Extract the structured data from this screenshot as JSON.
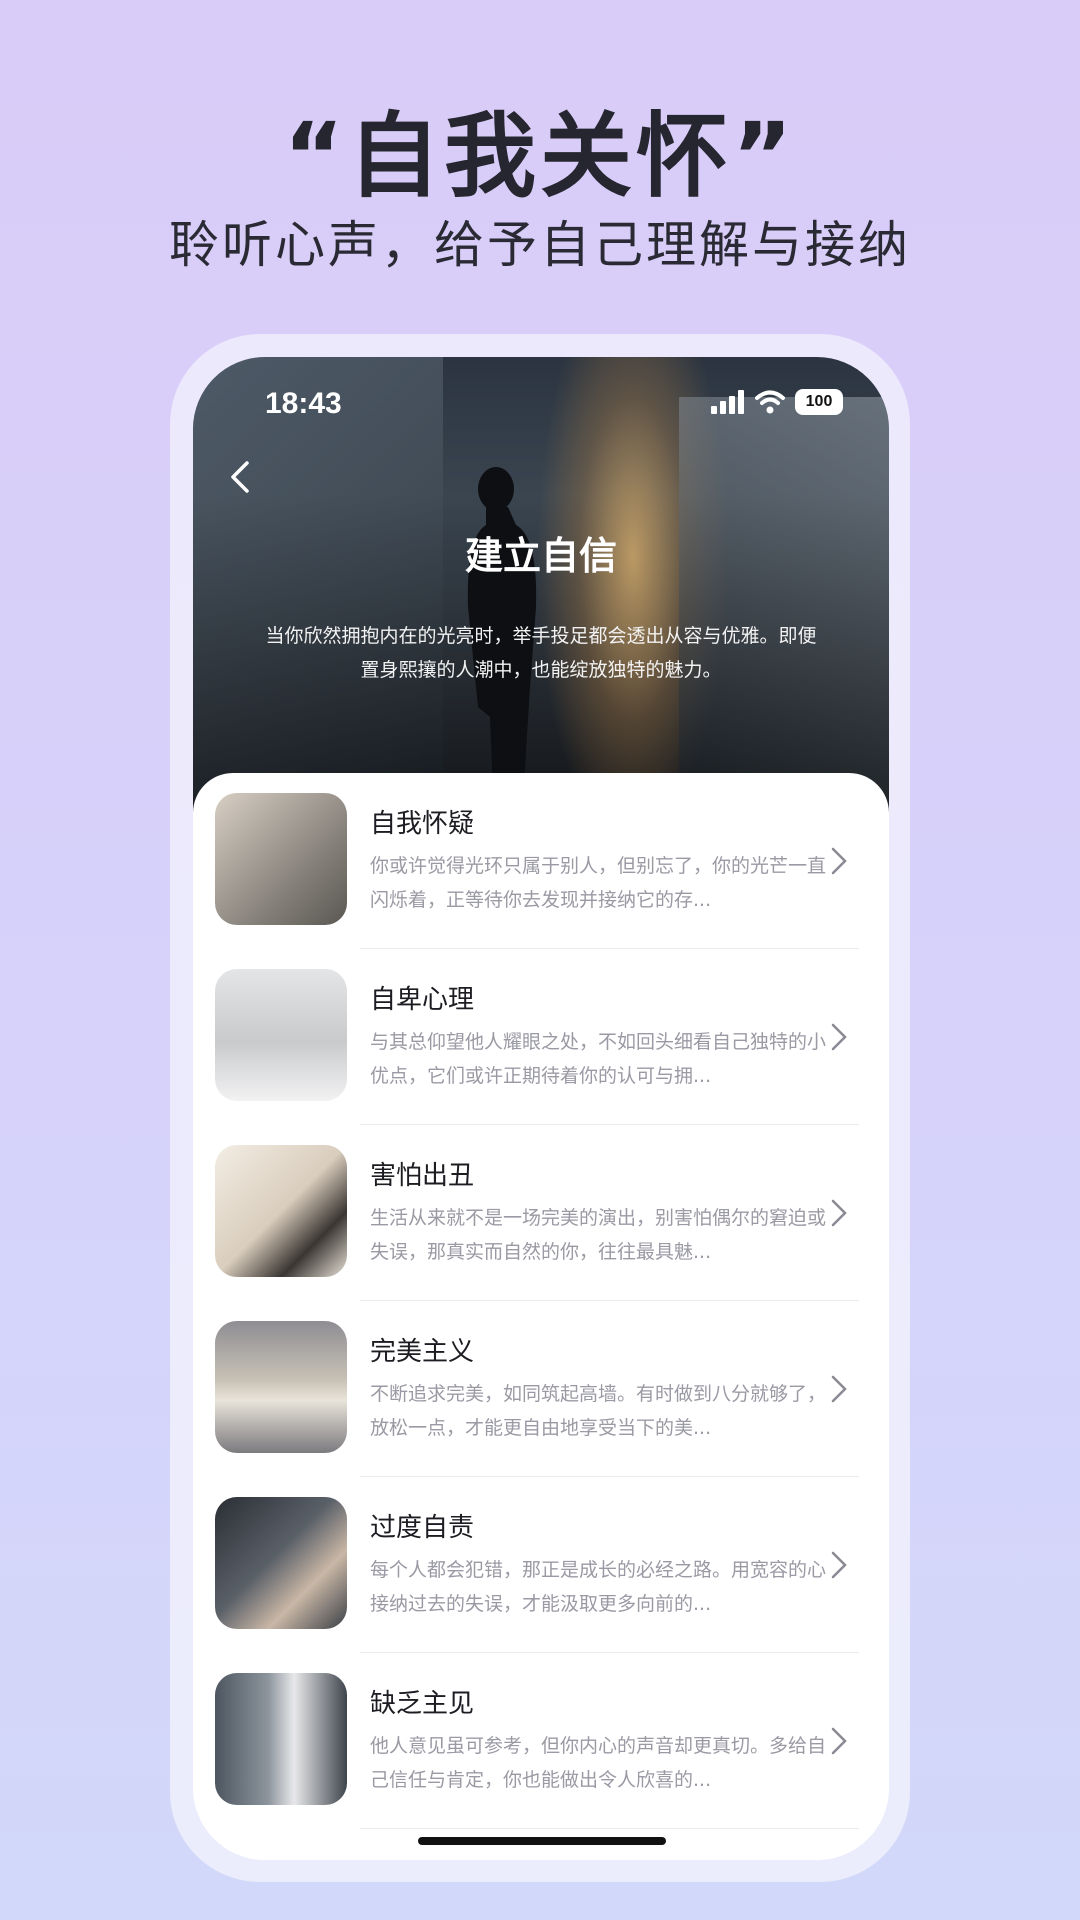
{
  "promo": {
    "title": "“自我关怀”",
    "subtitle": "聆听心声，给予自己理解与接纳"
  },
  "status_bar": {
    "time": "18:43",
    "battery": "100",
    "icons": [
      "signal-icon",
      "wifi-icon",
      "battery-icon"
    ]
  },
  "hero": {
    "back_icon": "chevron-left-icon",
    "title": "建立自信",
    "description": "当你欣然拥抱内在的光亮时，举手投足都会透出从容与优雅。即便置身熙攘的人潮中，也能绽放独特的魅力。"
  },
  "topics": [
    {
      "title": "自我怀疑",
      "desc": "你或许觉得光环只属于别人，但别忘了，你的光芒一直闪烁着，正等待你去发现并接纳它的存...",
      "thumb_color": "#b8b2a8"
    },
    {
      "title": "自卑心理",
      "desc": "与其总仰望他人耀眼之处，不如回头细看自己独特的小优点，它们或许正期待着你的认可与拥...",
      "thumb_color": "#d9dadb"
    },
    {
      "title": "害怕出丑",
      "desc": "生活从来就不是一场完美的演出，别害怕偶尔的窘迫或失误，那真实而自然的你，往往最具魅...",
      "thumb_color": "#e6ddd0"
    },
    {
      "title": "完美主义",
      "desc": "不断追求完美，如同筑起高墙。有时做到八分就够了，放松一点，才能更自由地享受当下的美...",
      "thumb_color": "#a9a6ab"
    },
    {
      "title": "过度自责",
      "desc": "每个人都会犯错，那正是成长的必经之路。用宽容的心接纳过去的失误，才能汲取更多向前的...",
      "thumb_color": "#4a4f57"
    },
    {
      "title": "缺乏主见",
      "desc": "他人意见虽可参考，但你内心的声音却更真切。多给自己信任与肯定，你也能做出令人欣喜的...",
      "thumb_color": "#6c747c"
    }
  ]
}
